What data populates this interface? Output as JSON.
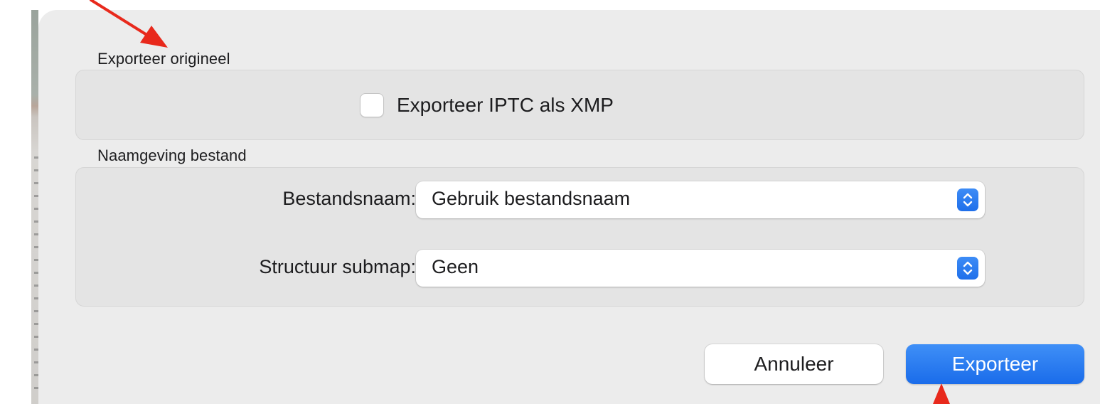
{
  "dialog": {
    "export_section": {
      "title": "Exporteer origineel",
      "checkbox_label": "Exporteer IPTC als XMP",
      "checkbox_checked": false
    },
    "naming_section": {
      "title": "Naamgeving bestand",
      "filename_label": "Bestandsnaam:",
      "filename_value": "Gebruik bestandsnaam",
      "subfolder_label": "Structuur submap:",
      "subfolder_value": "Geen"
    },
    "buttons": {
      "cancel_label": "Annuleer",
      "export_label": "Exporteer"
    }
  },
  "colors": {
    "accent": "#1a6cea",
    "annotation_arrow": "#e8291c",
    "dialog_background": "#ececec",
    "group_background": "#e4e4e4"
  },
  "icons": {
    "popup_stepper": "chevron-up-down-icon",
    "annotations": [
      "arrow-annotation-icon",
      "arrow-up-annotation-icon"
    ]
  }
}
